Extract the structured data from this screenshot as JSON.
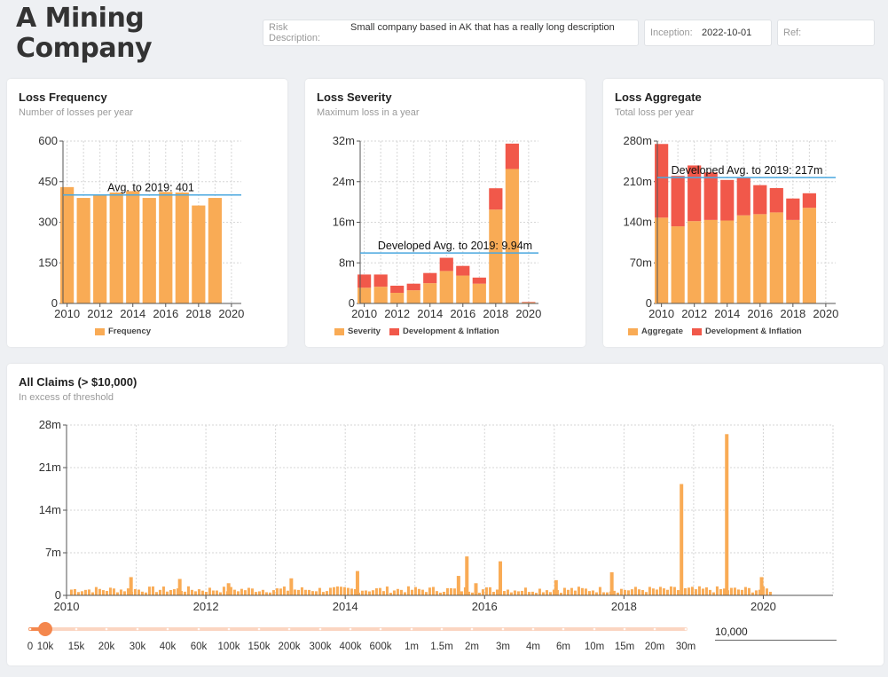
{
  "header": {
    "company_name_line1": "A Mining",
    "company_name_line2": "Company",
    "risk_label": "Risk Description:",
    "risk_value": "Small company based in AK that has a really long description",
    "inception_label": "Inception:",
    "inception_value": "2022-10-01",
    "ref_label": "Ref:",
    "ref_value": ""
  },
  "colors": {
    "base": "#f9ab55",
    "development": "#f1584a",
    "average_line": "#4aa8df",
    "slider": "#f4874d"
  },
  "frequency_card": {
    "title": "Loss Frequency",
    "subtitle": "Number of losses per year"
  },
  "severity_card": {
    "title": "Loss Severity",
    "subtitle": "Maximum loss in a year"
  },
  "aggregate_card": {
    "title": "Loss Aggregate",
    "subtitle": "Total loss per year"
  },
  "claims_card": {
    "title": "All Claims (> $10,000)",
    "subtitle": "In excess of threshold"
  },
  "chart_data": [
    {
      "type": "bar",
      "id": "frequency",
      "categories": [
        2010,
        2011,
        2012,
        2013,
        2014,
        2015,
        2016,
        2017,
        2018,
        2019,
        2020
      ],
      "series": [
        {
          "name": "Frequency",
          "values": [
            430,
            390,
            400,
            410,
            415,
            390,
            412,
            410,
            362,
            390,
            0
          ]
        }
      ],
      "x_ticks": [
        "2010",
        "2012",
        "2014",
        "2016",
        "2018",
        "2020"
      ],
      "y_ticks": [
        "0",
        "150",
        "300",
        "450",
        "600"
      ],
      "ylim": [
        0,
        600
      ],
      "average": {
        "value": 401,
        "label": "Avg. to 2019: 401"
      },
      "legend": [
        "Frequency"
      ],
      "grid": true
    },
    {
      "type": "bar",
      "id": "severity",
      "stacked": true,
      "categories": [
        2010,
        2011,
        2012,
        2013,
        2014,
        2015,
        2016,
        2017,
        2018,
        2019,
        2020
      ],
      "series": [
        {
          "name": "Severity",
          "values": [
            3.1,
            3.3,
            2.1,
            2.6,
            4.0,
            6.4,
            5.5,
            3.9,
            18.5,
            26.5,
            0.2
          ]
        },
        {
          "name": "Development & Inflation",
          "values": [
            2.6,
            2.4,
            1.4,
            1.3,
            2.0,
            2.6,
            1.9,
            1.2,
            4.2,
            5.0,
            0.1
          ]
        }
      ],
      "x_ticks": [
        "2010",
        "2012",
        "2014",
        "2016",
        "2018",
        "2020"
      ],
      "y_ticks": [
        "0",
        "8m",
        "16m",
        "24m",
        "32m"
      ],
      "ylim": [
        0,
        32
      ],
      "average": {
        "value": 9.94,
        "label": "Developed Avg. to 2019: 9.94m"
      },
      "legend": [
        "Severity",
        "Development & Inflation"
      ],
      "grid": true
    },
    {
      "type": "bar",
      "id": "aggregate",
      "stacked": true,
      "categories": [
        2010,
        2011,
        2012,
        2013,
        2014,
        2015,
        2016,
        2017,
        2018,
        2019,
        2020
      ],
      "series": [
        {
          "name": "Aggregate",
          "values": [
            148,
            133,
            142,
            144,
            143,
            152,
            154,
            157,
            144,
            165,
            0
          ]
        },
        {
          "name": "Development & Inflation",
          "values": [
            127,
            87,
            96,
            82,
            70,
            65,
            50,
            42,
            37,
            25,
            0
          ]
        }
      ],
      "x_ticks": [
        "2010",
        "2012",
        "2014",
        "2016",
        "2018",
        "2020"
      ],
      "y_ticks": [
        "0",
        "70m",
        "140m",
        "210m",
        "280m"
      ],
      "ylim": [
        0,
        280
      ],
      "average": {
        "value": 217,
        "label": "Developed Avg. to 2019: 217m"
      },
      "legend": [
        "Aggregate",
        "Development & Inflation"
      ],
      "grid": true
    },
    {
      "type": "bar",
      "id": "claims",
      "x_ticks": [
        "2010",
        "2012",
        "2014",
        "2016",
        "2018",
        "2020"
      ],
      "y_ticks": [
        "0",
        "7m",
        "14m",
        "21m",
        "28m"
      ],
      "xlim": [
        2010,
        2021
      ],
      "ylim": [
        0,
        28
      ],
      "background_claims_m": 1.2,
      "spikes": [
        {
          "x": 2010.9,
          "y": 3.0
        },
        {
          "x": 2011.6,
          "y": 2.7
        },
        {
          "x": 2012.3,
          "y": 2.0
        },
        {
          "x": 2013.2,
          "y": 2.8
        },
        {
          "x": 2014.15,
          "y": 4.0
        },
        {
          "x": 2015.6,
          "y": 3.2
        },
        {
          "x": 2015.72,
          "y": 6.4
        },
        {
          "x": 2015.85,
          "y": 2.0
        },
        {
          "x": 2016.2,
          "y": 5.6
        },
        {
          "x": 2017.0,
          "y": 2.5
        },
        {
          "x": 2017.8,
          "y": 3.8
        },
        {
          "x": 2018.8,
          "y": 18.3
        },
        {
          "x": 2019.45,
          "y": 26.5
        },
        {
          "x": 2019.95,
          "y": 3.0
        }
      ],
      "grid": true
    }
  ],
  "threshold_slider": {
    "ticks": [
      "0",
      "10k",
      "15k",
      "20k",
      "30k",
      "40k",
      "60k",
      "100k",
      "150k",
      "200k",
      "300k",
      "400k",
      "600k",
      "1m",
      "1.5m",
      "2m",
      "3m",
      "4m",
      "6m",
      "10m",
      "15m",
      "20m",
      "30m"
    ],
    "selected_index": 1,
    "input_value": "10,000"
  }
}
